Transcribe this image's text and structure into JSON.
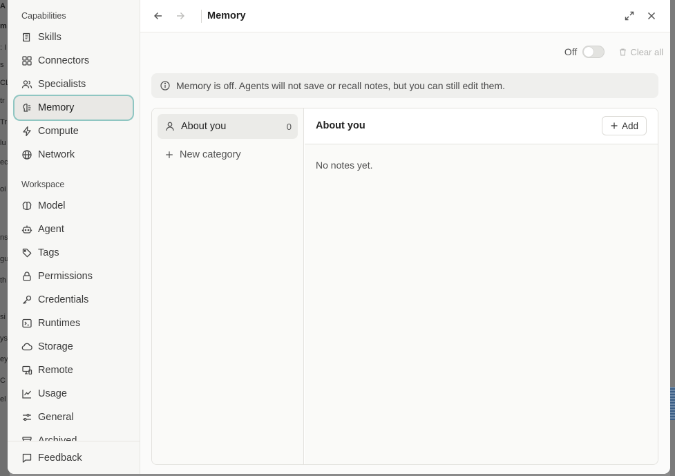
{
  "background_fragments": [
    "A",
    "m",
    ": I",
    "s",
    "CL",
    "tr",
    "Tr",
    "lu",
    "ec",
    "oi",
    "ns",
    "gu",
    "th",
    "si",
    "ys",
    "ey",
    "C",
    "el"
  ],
  "sidebar": {
    "capabilities_title": "Capabilities",
    "capabilities": [
      {
        "label": "Skills",
        "icon": "skills-icon"
      },
      {
        "label": "Connectors",
        "icon": "connectors-icon"
      },
      {
        "label": "Specialists",
        "icon": "specialists-icon"
      },
      {
        "label": "Memory",
        "icon": "memory-icon",
        "active": true
      },
      {
        "label": "Compute",
        "icon": "compute-icon"
      },
      {
        "label": "Network",
        "icon": "globe-icon"
      }
    ],
    "workspace_title": "Workspace",
    "workspace": [
      {
        "label": "Model",
        "icon": "brain-icon"
      },
      {
        "label": "Agent",
        "icon": "robot-icon"
      },
      {
        "label": "Tags",
        "icon": "tag-icon"
      },
      {
        "label": "Permissions",
        "icon": "lock-icon"
      },
      {
        "label": "Credentials",
        "icon": "key-icon"
      },
      {
        "label": "Runtimes",
        "icon": "terminal-icon"
      },
      {
        "label": "Storage",
        "icon": "cloud-icon"
      },
      {
        "label": "Remote",
        "icon": "remote-icon"
      },
      {
        "label": "Usage",
        "icon": "chart-icon"
      },
      {
        "label": "General",
        "icon": "sliders-icon"
      },
      {
        "label": "Archived",
        "icon": "archive-icon"
      }
    ],
    "feedback_label": "Feedback"
  },
  "header": {
    "title": "Memory"
  },
  "controls": {
    "toggle_label": "Off",
    "toggle_on": false,
    "clear_all_label": "Clear all"
  },
  "banner": {
    "text": "Memory is off. Agents will not save or recall notes, but you can still edit them."
  },
  "categories": {
    "items": [
      {
        "label": "About you",
        "count": "0",
        "icon": "person-icon"
      }
    ],
    "new_category_label": "New category"
  },
  "notes": {
    "title": "About you",
    "add_label": "Add",
    "empty_text": "No notes yet."
  },
  "colors": {
    "active_outline": "#8fc6c2",
    "sidebar_bg": "#f7f7f5",
    "banner_bg": "#efefed"
  }
}
